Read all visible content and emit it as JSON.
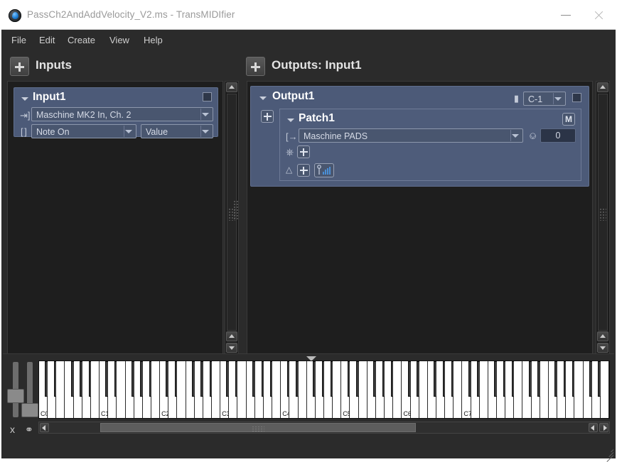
{
  "window": {
    "title": "PassCh2AndAddVelocity_V2.ms - TransMIDIfier",
    "app_icon": "transmidifier-globe-icon",
    "minimize_label": "",
    "close_label": ""
  },
  "menubar": {
    "items": [
      {
        "label": "File"
      },
      {
        "label": "Edit"
      },
      {
        "label": "Create"
      },
      {
        "label": "View"
      },
      {
        "label": "Help"
      }
    ]
  },
  "inputs_panel": {
    "header": "Inputs",
    "add_button": "+",
    "module": {
      "title": "Input1",
      "device": "Maschine MK2 In, Ch. 2",
      "event_type": "Note On",
      "event_value": "Value"
    }
  },
  "outputs_panel": {
    "header": "Outputs: Input1",
    "add_button": "+",
    "module": {
      "title": "Output1",
      "transpose": "C-1",
      "patch": {
        "title": "Patch1",
        "mono_badge": "M",
        "device": "Maschine PADS",
        "delay_value": "0"
      }
    }
  },
  "keyboard": {
    "octave_labels": [
      "C0",
      "C1",
      "C2",
      "C3",
      "C4",
      "C5",
      "C6",
      "C7"
    ],
    "pitch_slider": "pitch-bend",
    "mod_slider": "modulation-wheel"
  },
  "colors": {
    "module_bg": "#4c5a78",
    "module_border": "#606f8e",
    "field_bg": "#49566f",
    "work_bg": "#1e1e1e",
    "chrome_bg": "#2b2b2b",
    "accent_blue": "#4a8fd6"
  }
}
